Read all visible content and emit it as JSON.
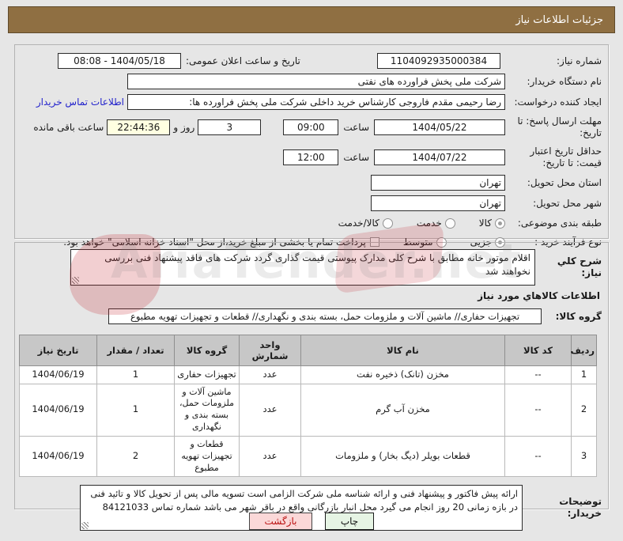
{
  "title": "جزئیات اطلاعات نیاز",
  "form": {
    "need_number": {
      "label": "شماره نیاز:",
      "value": "1104092935000384"
    },
    "announce_datetime": {
      "label": "تاریخ و ساعت اعلان عمومی:",
      "value": "1404/05/18 - 08:08"
    },
    "buyer_org": {
      "label": "نام دستگاه خریدار:",
      "value": "شرکت ملی پخش فراورده های نفتی"
    },
    "request_creator": {
      "label": "ایجاد کننده درخواست:",
      "value": "رضا رحیمی مقدم فاروجی  کارشناس خرید داخلی شرکت ملی پخش فراورده ها:",
      "link": "اطلاعات تماس خریدار"
    },
    "response_deadline": {
      "label": "مهلت ارسال پاسخ: تا تاریخ:",
      "date": "1404/05/22",
      "hour_label": "ساعت",
      "hour": "09:00",
      "days": "3",
      "days_label": "روز و",
      "countdown": "22:44:36",
      "countdown_label": "ساعت باقی مانده"
    },
    "price_validity": {
      "label": "حداقل تاریخ اعتبار قیمت: تا تاریخ:",
      "date": "1404/07/22",
      "hour_label": "ساعت",
      "hour": "12:00"
    },
    "province": {
      "label": "استان محل تحویل:",
      "value": "تهران"
    },
    "city": {
      "label": "شهر محل تحویل:",
      "value": "تهران"
    },
    "subject_class": {
      "label": "طبقه بندی موضوعی:",
      "options": [
        {
          "label": "کالا",
          "selected": true
        },
        {
          "label": "خدمت",
          "selected": false
        },
        {
          "label": "کالا/خدمت",
          "selected": false
        }
      ]
    },
    "purchase_process": {
      "label": "نوع فرآیند خرید :",
      "options": [
        {
          "label": "جزیی",
          "selected": true
        },
        {
          "label": "متوسط",
          "selected": false
        }
      ],
      "checkbox_label": "پرداخت تمام یا بخشی از مبلغ خرید،از محل \"اسناد خزانه اسلامی\" خواهد بود.",
      "checkbox_checked": false
    }
  },
  "need_description": {
    "label": "شرح کلي نیاز:",
    "value": "اقلام موتور خانه مطابق با شرح کلی مدارک پیوستی قیمت گذاری گردد شرکت های فاقد پیشنهاد فنی بررسی نخواهند شد"
  },
  "goods": {
    "header": "اطلاعات کالاهاي مورد نیاز",
    "group_label": "گروه کالا:",
    "group_value": "تجهیزات حفاری// ماشین آلات و ملزومات حمل، بسته بندی و نگهداری//  قطعات و تجهیزات تهویه مطبوع",
    "table": {
      "headers": [
        "ردیف",
        "کد کالا",
        "نام کالا",
        "واحد شمارش",
        "گروه کالا",
        "تعداد / مقدار",
        "تاریخ نیاز"
      ],
      "rows": [
        [
          "1",
          "--",
          "مخزن (تانک) ذخیره نفت",
          "عدد",
          "تجهیزات حفاری",
          "1",
          "1404/06/19"
        ],
        [
          "2",
          "--",
          "مخزن آب گرم",
          "عدد",
          "ماشین آلات و ملزومات حمل، بسته بندی و نگهداری",
          "1",
          "1404/06/19"
        ],
        [
          "3",
          "--",
          "قطعات بویلر (دیگ بخار) و ملزومات",
          "عدد",
          "قطعات و تجهیزات تهویه مطبوع",
          "2",
          "1404/06/19"
        ]
      ]
    }
  },
  "buyer_notes": {
    "label": "توضیحات خریدار:",
    "value": "ارائه پیش فاکتور و پیشنهاد فنی و ارائه شناسه ملی شرکت الزامی است تسویه مالی پس از تحویل کالا و تائید فنی در بازه زمانی 20 روز انجام می گیرد محل انبار بازرگانی واقع در باقر شهر می باشد شماره تماس 84121033"
  },
  "footer": {
    "print": "چاپ",
    "back": "بازگشت"
  },
  "watermark": {
    "text": "AriaTender.net"
  },
  "colors": {
    "titlebar": "#8f6f42",
    "countdown_bg": "#ffffe1",
    "print_btn": "#e6f4e4",
    "back_btn": "#fbd8d8",
    "link": "#2222cc"
  }
}
